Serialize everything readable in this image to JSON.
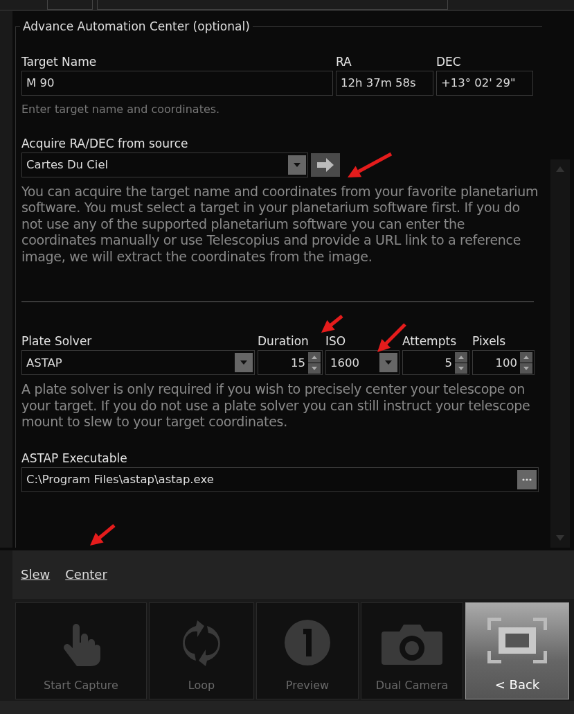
{
  "group": {
    "title": "Advance Automation Center (optional)"
  },
  "target": {
    "fields": [
      {
        "label": "Target Name",
        "value": "M 90"
      },
      {
        "label": "RA",
        "value": "12h 37m 58s"
      },
      {
        "label": "DEC",
        "value": "+13° 02' 29\""
      }
    ],
    "hint": "Enter target name and coordinates."
  },
  "source": {
    "label": "Acquire RA/DEC from source",
    "value": "Cartes Du Ciel",
    "description": "You can acquire the target name and coordinates from your favorite planetarium software. You must select a target in your planetarium software first.  If you do not use any of the supported planetarium software you can enter the coordinates manually or use Telescopius and provide a URL link to a reference image, we will extract the coordinates from the image."
  },
  "solver": {
    "fields": [
      {
        "kind": "dropdown",
        "label": "Plate Solver",
        "value": "ASTAP"
      },
      {
        "kind": "spinner",
        "label": "Duration",
        "value": "15"
      },
      {
        "kind": "dropdown",
        "label": "ISO",
        "value": "1600"
      },
      {
        "kind": "spinner",
        "label": "Attempts",
        "value": "5"
      },
      {
        "kind": "spinner",
        "label": "Pixels",
        "value": "100"
      }
    ],
    "hint": "A plate solver is only required if you wish to precisely center your telescope on your target.  If you do not use a plate solver you can still instruct your telescope mount to slew to your target coordinates.",
    "executable_label": "ASTAP Executable",
    "executable": "C:\\Program Files\\astap\\astap.exe"
  },
  "links": [
    "Slew",
    "Center"
  ],
  "toolbar": [
    {
      "kind": "hand",
      "label": "Start Capture",
      "disabled": true
    },
    {
      "kind": "loop",
      "label": "Loop",
      "disabled": true
    },
    {
      "kind": "preview",
      "label": "Preview",
      "disabled": true
    },
    {
      "kind": "camera",
      "label": "Dual Camera",
      "disabled": true
    },
    {
      "kind": "frame",
      "label": "< Back",
      "disabled": false
    }
  ]
}
